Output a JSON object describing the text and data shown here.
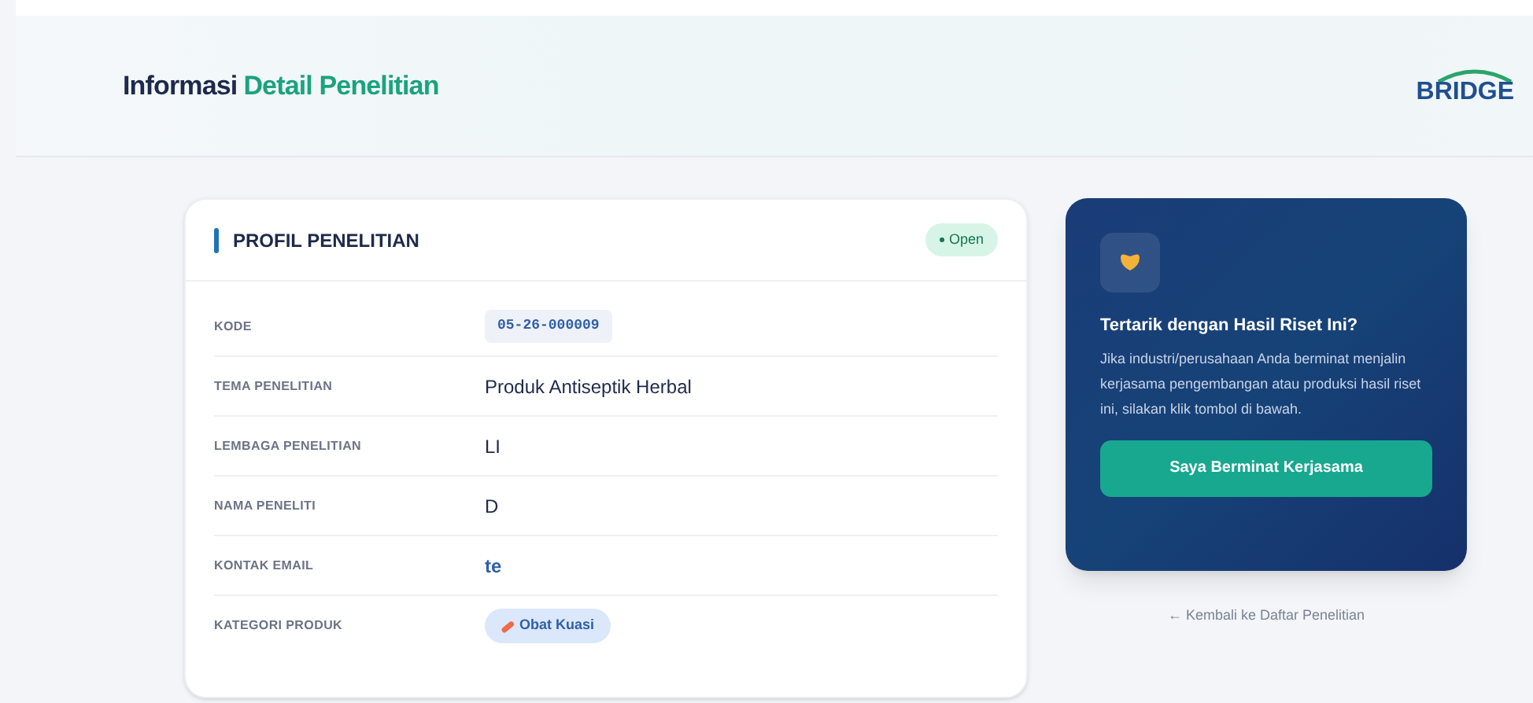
{
  "header": {
    "title_part_1": "Informasi",
    "title_part_2": "Detail Penelitian",
    "logo": "BRIDGE"
  },
  "profile": {
    "title": "PROFIL PENELITIAN",
    "status": "Open",
    "rows": [
      {
        "label": "KODE",
        "value": "05-26-000009",
        "kind": "code"
      },
      {
        "label": "TEMA PENELITIAN",
        "value": "Produk Antiseptik Herbal",
        "kind": "text"
      },
      {
        "label": "LEMBAGA PENELITIAN",
        "value": "LI",
        "kind": "text"
      },
      {
        "label": "NAMA PENELITI",
        "value": "D",
        "kind": "text"
      },
      {
        "label": "KONTAK EMAIL",
        "value": "te",
        "kind": "email"
      },
      {
        "label": "KATEGORI PRODUK",
        "value": "Obat Kuasi",
        "kind": "tag"
      }
    ]
  },
  "cta": {
    "title": "Tertarik dengan Hasil Riset Ini?",
    "text": "Jika industri/perusahaan Anda berminat menjalin kerjasama pengembangan atau produksi hasil riset ini, silakan klik tombol di bawah.",
    "button": "Saya Berminat Kerjasama"
  },
  "back_link": "← Kembali ke Daftar Penelitian"
}
